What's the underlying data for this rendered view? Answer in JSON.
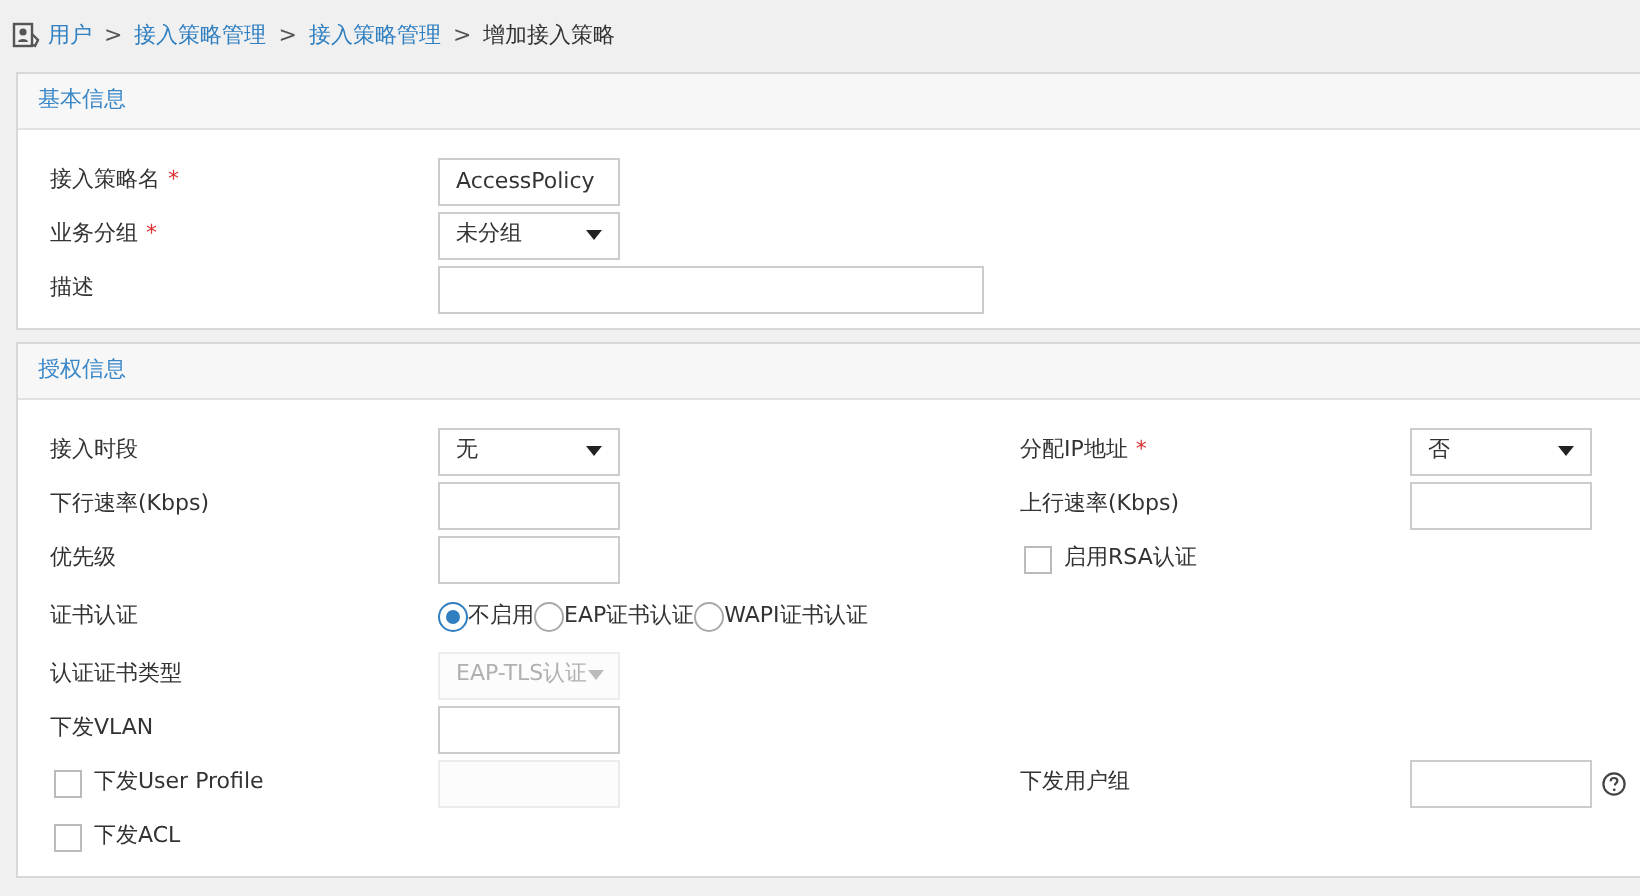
{
  "breadcrumb": {
    "separator": ">",
    "items": [
      {
        "text": "用户",
        "link": true
      },
      {
        "text": "接入策略管理",
        "link": true
      },
      {
        "text": "接入策略管理",
        "link": true
      },
      {
        "text": "增加接入策略",
        "link": false
      }
    ]
  },
  "sections": [
    {
      "title": "基本信息",
      "rows": [
        {
          "left": {
            "kind": "field",
            "label": "接入策略名",
            "required_mark": "*",
            "control": {
              "kind": "input",
              "value": "AccessPolicy",
              "disabled": false
            }
          }
        },
        {
          "left": {
            "kind": "field",
            "label": "业务分组",
            "required_mark": "*",
            "control": {
              "kind": "select",
              "value": "未分组",
              "disabled": false
            }
          }
        },
        {
          "left": {
            "kind": "field",
            "label": "描述",
            "control": {
              "kind": "wide-input",
              "disabled": false
            }
          }
        }
      ]
    },
    {
      "title": "授权信息",
      "rows": [
        {
          "left": {
            "kind": "field",
            "label": "接入时段",
            "control": {
              "kind": "select",
              "value": "无",
              "disabled": false
            }
          },
          "right": {
            "kind": "field",
            "label": "分配IP地址",
            "required_mark": "*",
            "control": {
              "kind": "select",
              "value": "否",
              "disabled": false
            }
          }
        },
        {
          "left": {
            "kind": "field",
            "label": "下行速率(Kbps)",
            "control": {
              "kind": "input",
              "disabled": false
            }
          },
          "right": {
            "kind": "field",
            "label": "上行速率(Kbps)",
            "control": {
              "kind": "input",
              "disabled": false
            }
          }
        },
        {
          "left": {
            "kind": "field",
            "label": "优先级",
            "control": {
              "kind": "input",
              "disabled": false
            }
          },
          "right": {
            "kind": "checkbox",
            "label": "启用RSA认证",
            "checked": false
          }
        },
        {
          "left": {
            "kind": "field",
            "label": "证书认证",
            "control": {
              "kind": "radios",
              "options": [
                {
                  "label": "不启用",
                  "selected": true
                },
                {
                  "label": "EAP证书认证",
                  "selected": false
                },
                {
                  "label": "WAPI证书认证",
                  "selected": false
                }
              ]
            }
          }
        },
        {
          "left": {
            "kind": "field",
            "label": "认证证书类型",
            "control": {
              "kind": "select",
              "value": "EAP-TLS认证",
              "disabled": true
            }
          }
        },
        {
          "left": {
            "kind": "field",
            "label": "下发VLAN",
            "control": {
              "kind": "input",
              "disabled": false
            }
          }
        },
        {
          "left": {
            "kind": "checkbox",
            "label": "下发User Profile",
            "checked": false,
            "control": {
              "kind": "input",
              "disabled": true
            }
          },
          "right": {
            "kind": "field",
            "label": "下发用户组",
            "help": true,
            "control": {
              "kind": "input",
              "disabled": false
            }
          }
        },
        {
          "left": {
            "kind": "checkbox",
            "label": "下发ACL",
            "checked": false
          }
        }
      ]
    }
  ]
}
